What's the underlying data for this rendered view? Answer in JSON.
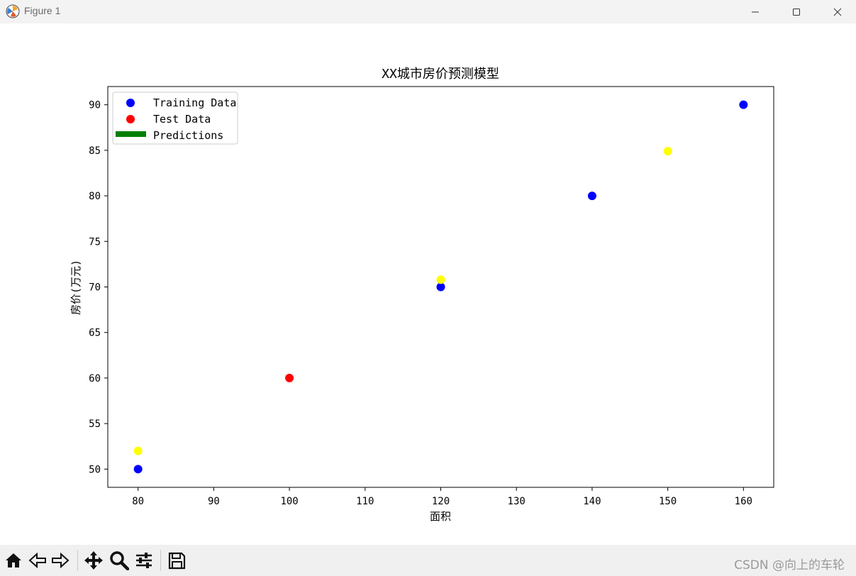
{
  "window": {
    "title": "Figure 1"
  },
  "toolbar": {
    "buttons": [
      "home-icon",
      "back-icon",
      "forward-icon",
      "pan-icon",
      "zoom-icon",
      "configure-icon",
      "save-icon"
    ]
  },
  "watermark": "CSDN @向上的车轮",
  "colors": {
    "training": "#0000ff",
    "test": "#ff0000",
    "predictions": "#ffff00",
    "legend_predictions_line": "#008000"
  },
  "chart_data": {
    "type": "scatter",
    "title": "XX城市房价预测模型",
    "xlabel": "面积",
    "ylabel": "房价(万元)",
    "xlim": [
      76,
      164
    ],
    "ylim": [
      48,
      92
    ],
    "xticks": [
      80,
      90,
      100,
      110,
      120,
      130,
      140,
      150,
      160
    ],
    "yticks": [
      50,
      55,
      60,
      65,
      70,
      75,
      80,
      85,
      90
    ],
    "legend_position": "top-left",
    "legend": [
      {
        "label": "Training Data",
        "marker": "circle",
        "color": "#0000ff"
      },
      {
        "label": "Test Data",
        "marker": "circle",
        "color": "#ff0000"
      },
      {
        "label": "Predictions",
        "marker": "line",
        "color": "#008000"
      }
    ],
    "series": [
      {
        "name": "Training Data",
        "color": "#0000ff",
        "points": [
          {
            "x": 80,
            "y": 50
          },
          {
            "x": 120,
            "y": 70
          },
          {
            "x": 140,
            "y": 80
          },
          {
            "x": 160,
            "y": 90
          }
        ]
      },
      {
        "name": "Test Data",
        "color": "#ff0000",
        "points": [
          {
            "x": 100,
            "y": 60
          }
        ]
      },
      {
        "color": "#ffff00",
        "points": [
          {
            "x": 80,
            "y": 52
          },
          {
            "x": 120,
            "y": 70.8
          },
          {
            "x": 150,
            "y": 84.9
          }
        ]
      }
    ]
  }
}
